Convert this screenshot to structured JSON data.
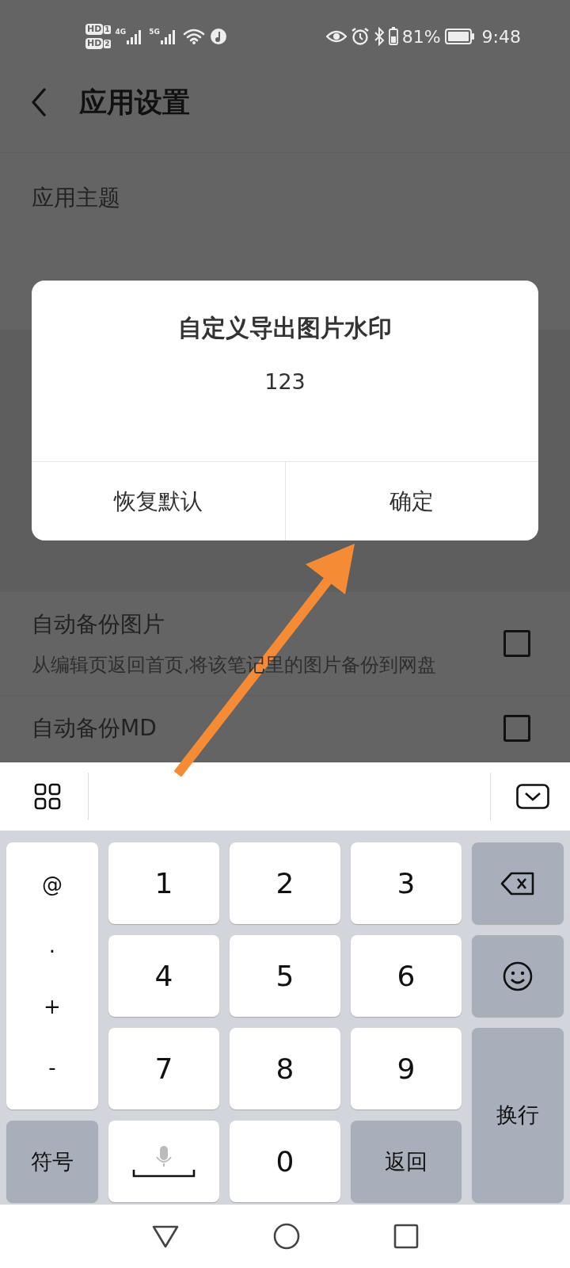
{
  "status_bar": {
    "sims": [
      {
        "badge": "HD",
        "slot": "1"
      },
      {
        "badge": "HD",
        "slot": "2"
      }
    ],
    "networks": [
      "4G",
      "5G"
    ],
    "battery_percent": "81%",
    "time": "9:48"
  },
  "header": {
    "title": "应用设置"
  },
  "settings": [
    {
      "kind": "plain",
      "title": "应用主题"
    },
    {
      "kind": "gap"
    },
    {
      "kind": "checkbox",
      "title": "自动备份图片",
      "subtitle": "从编辑页返回首页,将该笔记里的图片备份到网盘",
      "checked": false
    },
    {
      "kind": "checkbox",
      "title": "自动备份MD",
      "checked": false
    }
  ],
  "dialog": {
    "title": "自定义导出图片水印",
    "value": "123",
    "buttons": [
      "恢复默认",
      "确定"
    ]
  },
  "keyboard": {
    "keys": [
      {
        "kind": "column",
        "labels": [
          "@",
          ".",
          "+",
          "-"
        ]
      },
      {
        "kind": "digit",
        "label": "1"
      },
      {
        "kind": "digit",
        "label": "2"
      },
      {
        "kind": "digit",
        "label": "3"
      },
      {
        "kind": "backspace"
      },
      {
        "kind": "digit",
        "label": "4"
      },
      {
        "kind": "digit",
        "label": "5"
      },
      {
        "kind": "digit",
        "label": "6"
      },
      {
        "kind": "emoji"
      },
      {
        "kind": "digit",
        "label": "7"
      },
      {
        "kind": "digit",
        "label": "8"
      },
      {
        "kind": "digit",
        "label": "9"
      },
      {
        "kind": "enter",
        "label": "换行"
      },
      {
        "kind": "function",
        "label": "符号"
      },
      {
        "kind": "mic"
      },
      {
        "kind": "digit",
        "label": "0"
      },
      {
        "kind": "function",
        "label": "返回"
      }
    ]
  }
}
